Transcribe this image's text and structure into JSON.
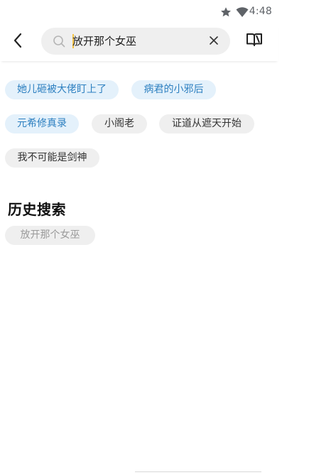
{
  "status_bar": {
    "time": "4:48",
    "icons": [
      "star-icon",
      "wifi-icon"
    ],
    "icon_color": "#5f6368"
  },
  "top_bar": {
    "back_icon": "chevron-left-icon",
    "search": {
      "value": "放开那个女巫",
      "icon": "search-icon"
    },
    "clear_icon": "close-icon",
    "bookshelf_icon": "book-icon"
  },
  "hot_tags": [
    {
      "label": "她儿砸被大佬盯上了",
      "style": "hot"
    },
    {
      "label": "病君的小邪后",
      "style": "hot"
    },
    {
      "label": "元希修真录",
      "style": "hot"
    },
    {
      "label": "小阁老",
      "style": "plain"
    },
    {
      "label": "证道从遮天开始",
      "style": "plain"
    },
    {
      "label": "我不可能是剑神",
      "style": "plain"
    }
  ],
  "history": {
    "title": "历史搜索",
    "items": [
      "放开那个女巫"
    ]
  },
  "colors": {
    "hot_tag_bg": "#e4f1fb",
    "hot_tag_text": "#2c7fc0",
    "plain_tag_bg": "#efefef",
    "cursor": "#f6c343"
  }
}
